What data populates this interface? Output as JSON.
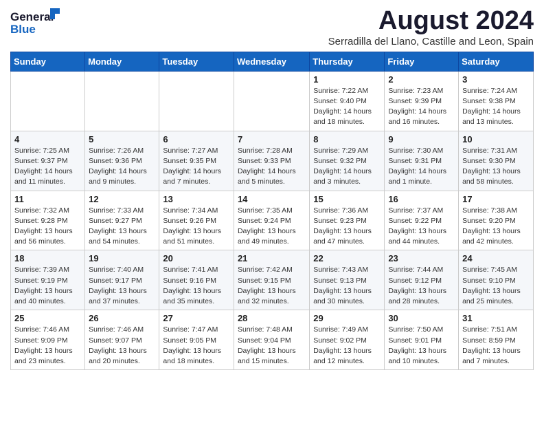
{
  "header": {
    "logo_general": "General",
    "logo_blue": "Blue",
    "month_title": "August 2024",
    "subtitle": "Serradilla del Llano, Castille and Leon, Spain"
  },
  "columns": [
    "Sunday",
    "Monday",
    "Tuesday",
    "Wednesday",
    "Thursday",
    "Friday",
    "Saturday"
  ],
  "weeks": [
    [
      {
        "day": "",
        "info": ""
      },
      {
        "day": "",
        "info": ""
      },
      {
        "day": "",
        "info": ""
      },
      {
        "day": "",
        "info": ""
      },
      {
        "day": "1",
        "info": "Sunrise: 7:22 AM\nSunset: 9:40 PM\nDaylight: 14 hours\nand 18 minutes."
      },
      {
        "day": "2",
        "info": "Sunrise: 7:23 AM\nSunset: 9:39 PM\nDaylight: 14 hours\nand 16 minutes."
      },
      {
        "day": "3",
        "info": "Sunrise: 7:24 AM\nSunset: 9:38 PM\nDaylight: 14 hours\nand 13 minutes."
      }
    ],
    [
      {
        "day": "4",
        "info": "Sunrise: 7:25 AM\nSunset: 9:37 PM\nDaylight: 14 hours\nand 11 minutes."
      },
      {
        "day": "5",
        "info": "Sunrise: 7:26 AM\nSunset: 9:36 PM\nDaylight: 14 hours\nand 9 minutes."
      },
      {
        "day": "6",
        "info": "Sunrise: 7:27 AM\nSunset: 9:35 PM\nDaylight: 14 hours\nand 7 minutes."
      },
      {
        "day": "7",
        "info": "Sunrise: 7:28 AM\nSunset: 9:33 PM\nDaylight: 14 hours\nand 5 minutes."
      },
      {
        "day": "8",
        "info": "Sunrise: 7:29 AM\nSunset: 9:32 PM\nDaylight: 14 hours\nand 3 minutes."
      },
      {
        "day": "9",
        "info": "Sunrise: 7:30 AM\nSunset: 9:31 PM\nDaylight: 14 hours\nand 1 minute."
      },
      {
        "day": "10",
        "info": "Sunrise: 7:31 AM\nSunset: 9:30 PM\nDaylight: 13 hours\nand 58 minutes."
      }
    ],
    [
      {
        "day": "11",
        "info": "Sunrise: 7:32 AM\nSunset: 9:28 PM\nDaylight: 13 hours\nand 56 minutes."
      },
      {
        "day": "12",
        "info": "Sunrise: 7:33 AM\nSunset: 9:27 PM\nDaylight: 13 hours\nand 54 minutes."
      },
      {
        "day": "13",
        "info": "Sunrise: 7:34 AM\nSunset: 9:26 PM\nDaylight: 13 hours\nand 51 minutes."
      },
      {
        "day": "14",
        "info": "Sunrise: 7:35 AM\nSunset: 9:24 PM\nDaylight: 13 hours\nand 49 minutes."
      },
      {
        "day": "15",
        "info": "Sunrise: 7:36 AM\nSunset: 9:23 PM\nDaylight: 13 hours\nand 47 minutes."
      },
      {
        "day": "16",
        "info": "Sunrise: 7:37 AM\nSunset: 9:22 PM\nDaylight: 13 hours\nand 44 minutes."
      },
      {
        "day": "17",
        "info": "Sunrise: 7:38 AM\nSunset: 9:20 PM\nDaylight: 13 hours\nand 42 minutes."
      }
    ],
    [
      {
        "day": "18",
        "info": "Sunrise: 7:39 AM\nSunset: 9:19 PM\nDaylight: 13 hours\nand 40 minutes."
      },
      {
        "day": "19",
        "info": "Sunrise: 7:40 AM\nSunset: 9:17 PM\nDaylight: 13 hours\nand 37 minutes."
      },
      {
        "day": "20",
        "info": "Sunrise: 7:41 AM\nSunset: 9:16 PM\nDaylight: 13 hours\nand 35 minutes."
      },
      {
        "day": "21",
        "info": "Sunrise: 7:42 AM\nSunset: 9:15 PM\nDaylight: 13 hours\nand 32 minutes."
      },
      {
        "day": "22",
        "info": "Sunrise: 7:43 AM\nSunset: 9:13 PM\nDaylight: 13 hours\nand 30 minutes."
      },
      {
        "day": "23",
        "info": "Sunrise: 7:44 AM\nSunset: 9:12 PM\nDaylight: 13 hours\nand 28 minutes."
      },
      {
        "day": "24",
        "info": "Sunrise: 7:45 AM\nSunset: 9:10 PM\nDaylight: 13 hours\nand 25 minutes."
      }
    ],
    [
      {
        "day": "25",
        "info": "Sunrise: 7:46 AM\nSunset: 9:09 PM\nDaylight: 13 hours\nand 23 minutes."
      },
      {
        "day": "26",
        "info": "Sunrise: 7:46 AM\nSunset: 9:07 PM\nDaylight: 13 hours\nand 20 minutes."
      },
      {
        "day": "27",
        "info": "Sunrise: 7:47 AM\nSunset: 9:05 PM\nDaylight: 13 hours\nand 18 minutes."
      },
      {
        "day": "28",
        "info": "Sunrise: 7:48 AM\nSunset: 9:04 PM\nDaylight: 13 hours\nand 15 minutes."
      },
      {
        "day": "29",
        "info": "Sunrise: 7:49 AM\nSunset: 9:02 PM\nDaylight: 13 hours\nand 12 minutes."
      },
      {
        "day": "30",
        "info": "Sunrise: 7:50 AM\nSunset: 9:01 PM\nDaylight: 13 hours\nand 10 minutes."
      },
      {
        "day": "31",
        "info": "Sunrise: 7:51 AM\nSunset: 8:59 PM\nDaylight: 13 hours\nand 7 minutes."
      }
    ]
  ]
}
